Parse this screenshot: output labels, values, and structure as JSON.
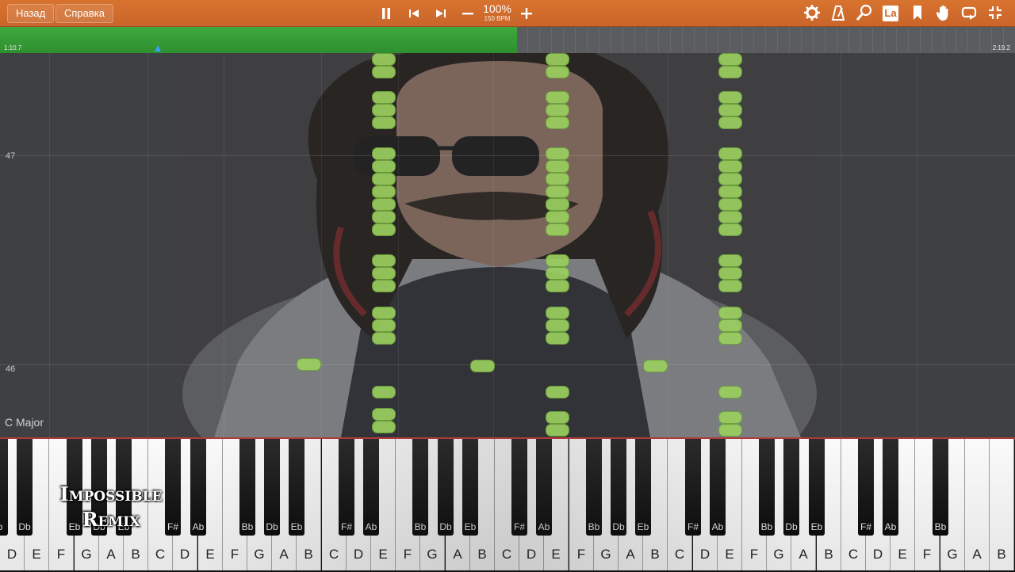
{
  "toolbar": {
    "back_label": "Назад",
    "help_label": "Справка",
    "pause_icon": "pause-icon",
    "prev_icon": "skip-back-icon",
    "next_icon": "skip-forward-icon",
    "zoom_out_icon": "minus-icon",
    "zoom_in_icon": "plus-icon",
    "zoom_percent": "100%",
    "bpm": "150 BPM",
    "right_icons": [
      "gear-icon",
      "metronome-icon",
      "search-icon",
      "la-label-icon",
      "bookmark-icon",
      "hand-icon",
      "loop-icon",
      "shrink-icon"
    ],
    "la_label": "La",
    "accent": "#c9652a"
  },
  "progress": {
    "start_time": "1:10.7",
    "end_time": "2:19.2",
    "played_fraction": 0.509,
    "played_color": "#36a036"
  },
  "roll": {
    "measure_top": "47",
    "measure_bottom": "46",
    "key_signature": "C Major",
    "note_color": "#9bcf5f"
  },
  "keyboard": {
    "white_keys": [
      "D",
      "E",
      "F",
      "G",
      "A",
      "B",
      "C",
      "D",
      "E",
      "F",
      "G",
      "A",
      "B",
      "C",
      "D",
      "E",
      "F",
      "G",
      "A",
      "B",
      "C",
      "D",
      "E",
      "F",
      "G",
      "A",
      "B",
      "C",
      "D",
      "E",
      "F",
      "G",
      "A",
      "B",
      "C",
      "D",
      "E",
      "F",
      "G",
      "A",
      "B"
    ],
    "black_keys": [
      "Db",
      "Eb",
      "Db",
      "Eb",
      "F#",
      "Ab",
      "Bb",
      "Db",
      "Eb",
      "F#",
      "Ab",
      "Bb",
      "Db",
      "Eb",
      "F#",
      "Ab",
      "Bb",
      "Db",
      "Eb",
      "F#",
      "Ab",
      "Bb",
      "Db",
      "Eb",
      "F#",
      "Ab",
      "Bb"
    ],
    "leading_black": "b"
  },
  "watermark": {
    "line1": "Impossible",
    "line2": "Remix"
  }
}
